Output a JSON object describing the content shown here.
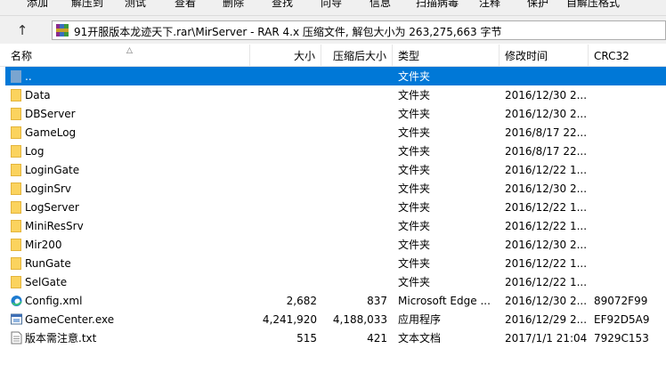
{
  "toolbar": {
    "buttons": [
      "添加",
      "解压到",
      "测试",
      "查看",
      "删除",
      "查找",
      "向导",
      "信息",
      "扫描病毒",
      "注释",
      "保护",
      "自解压格式"
    ]
  },
  "address": {
    "path": "91开服版本龙迹天下.rar\\MirServer - RAR 4.x 压缩文件, 解包大小为 263,275,663 字节"
  },
  "columns": {
    "name": "名称",
    "size": "大小",
    "packed": "压缩后大小",
    "type": "类型",
    "modified": "修改时间",
    "crc": "CRC32"
  },
  "rows": [
    {
      "name": "..",
      "size": "",
      "packed": "",
      "type": "文件夹",
      "modified": "",
      "crc": "",
      "icon": "up-folder-icon",
      "selected": true
    },
    {
      "name": "Data",
      "size": "",
      "packed": "",
      "type": "文件夹",
      "modified": "2016/12/30 2...",
      "crc": "",
      "icon": "folder-icon"
    },
    {
      "name": "DBServer",
      "size": "",
      "packed": "",
      "type": "文件夹",
      "modified": "2016/12/30 2...",
      "crc": "",
      "icon": "folder-icon"
    },
    {
      "name": "GameLog",
      "size": "",
      "packed": "",
      "type": "文件夹",
      "modified": "2016/8/17 22...",
      "crc": "",
      "icon": "folder-icon"
    },
    {
      "name": "Log",
      "size": "",
      "packed": "",
      "type": "文件夹",
      "modified": "2016/8/17 22...",
      "crc": "",
      "icon": "folder-icon"
    },
    {
      "name": "LoginGate",
      "size": "",
      "packed": "",
      "type": "文件夹",
      "modified": "2016/12/22 1...",
      "crc": "",
      "icon": "folder-icon"
    },
    {
      "name": "LoginSrv",
      "size": "",
      "packed": "",
      "type": "文件夹",
      "modified": "2016/12/30 2...",
      "crc": "",
      "icon": "folder-icon"
    },
    {
      "name": "LogServer",
      "size": "",
      "packed": "",
      "type": "文件夹",
      "modified": "2016/12/22 1...",
      "crc": "",
      "icon": "folder-icon"
    },
    {
      "name": "MiniResSrv",
      "size": "",
      "packed": "",
      "type": "文件夹",
      "modified": "2016/12/22 1...",
      "crc": "",
      "icon": "folder-icon"
    },
    {
      "name": "Mir200",
      "size": "",
      "packed": "",
      "type": "文件夹",
      "modified": "2016/12/30 2...",
      "crc": "",
      "icon": "folder-icon"
    },
    {
      "name": "RunGate",
      "size": "",
      "packed": "",
      "type": "文件夹",
      "modified": "2016/12/22 1...",
      "crc": "",
      "icon": "folder-icon"
    },
    {
      "name": "SelGate",
      "size": "",
      "packed": "",
      "type": "文件夹",
      "modified": "2016/12/22 1...",
      "crc": "",
      "icon": "folder-icon"
    },
    {
      "name": "Config.xml",
      "size": "2,682",
      "packed": "837",
      "type": "Microsoft Edge ...",
      "modified": "2016/12/30 2...",
      "crc": "89072F99",
      "icon": "edge-icon"
    },
    {
      "name": "GameCenter.exe",
      "size": "4,241,920",
      "packed": "4,188,033",
      "type": "应用程序",
      "modified": "2016/12/29 2...",
      "crc": "EF92D5A9",
      "icon": "exe-icon"
    },
    {
      "name": "版本需注意.txt",
      "size": "515",
      "packed": "421",
      "type": "文本文档",
      "modified": "2017/1/1 21:04",
      "crc": "7929C153",
      "icon": "text-file-icon"
    }
  ]
}
